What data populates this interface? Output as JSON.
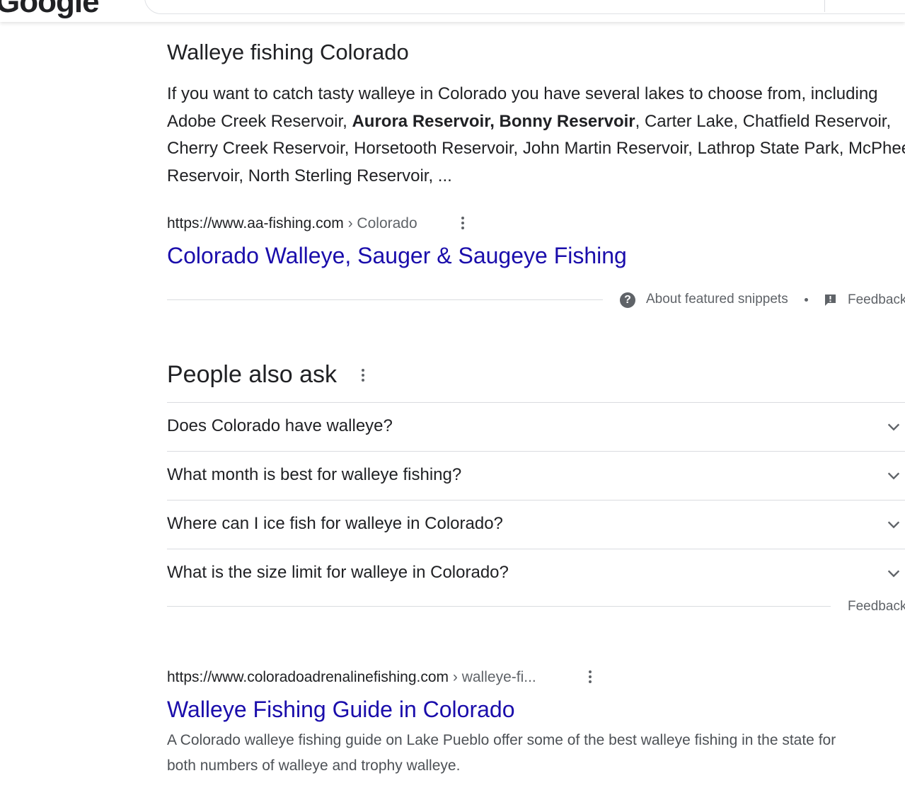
{
  "header": {
    "logo_text": "Google"
  },
  "featured_snippet": {
    "heading": "Walleye fishing Colorado",
    "text_parts": {
      "p1": "If you want to catch tasty walleye in Colorado you have several lakes to choose from, including Adobe Creek Reservoir, ",
      "bold": "Aurora Reservoir, Bonny Reservoir",
      "p2": ", Carter Lake, Chatfield Reservoir, Cherry Creek Reservoir, Horsetooth Reservoir, John Martin Reservoir, Lathrop State Park, McPhee Reservoir, North Sterling Reservoir, ..."
    },
    "source_url": "https://www.aa-fishing.com",
    "source_crumb": " › Colorado",
    "title": "Colorado Walleye, Sauger & Saugeye Fishing",
    "about_label": "About featured snippets",
    "feedback_label": "Feedback"
  },
  "people_also_ask": {
    "heading": "People also ask",
    "questions": [
      "Does Colorado have walleye?",
      "What month is best for walleye fishing?",
      "Where can I ice fish for walleye in Colorado?",
      "What is the size limit for walleye in Colorado?"
    ],
    "feedback_label": "Feedback"
  },
  "result": {
    "url": "https://www.coloradoadrenalinefishing.com",
    "crumb": " › walleye-fi...",
    "title": "Walleye Fishing Guide in Colorado",
    "description": "A Colorado walleye fishing guide on Lake Pueblo offer some of the best walleye fishing in the state for both numbers of walleye and trophy walleye."
  },
  "colors": {
    "link": "#1a0dab",
    "text": "#202124",
    "secondary": "#5f6368",
    "divider": "#dadce0"
  },
  "icons": [
    "help-circle-icon",
    "feedback-flag-icon",
    "more-vert-icon",
    "chevron-down-icon"
  ]
}
